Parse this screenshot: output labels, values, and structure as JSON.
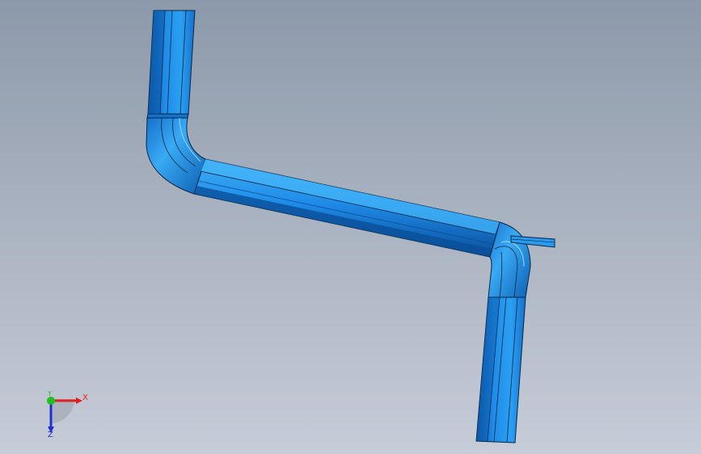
{
  "viewport": {
    "background_top": "#8c99aa",
    "background_bottom": "#c6ccd8"
  },
  "model": {
    "part": "bent-square-tube",
    "color_main": "#1f8be8",
    "color_light": "#59bdf8",
    "color_dark": "#0a4f9a",
    "edge_color": "#062642"
  },
  "triad": {
    "x_label": "X",
    "y_label": "Y",
    "z_label": "Z",
    "x_color": "#e02020",
    "y_color": "#20c020",
    "z_color": "#2030d0"
  }
}
